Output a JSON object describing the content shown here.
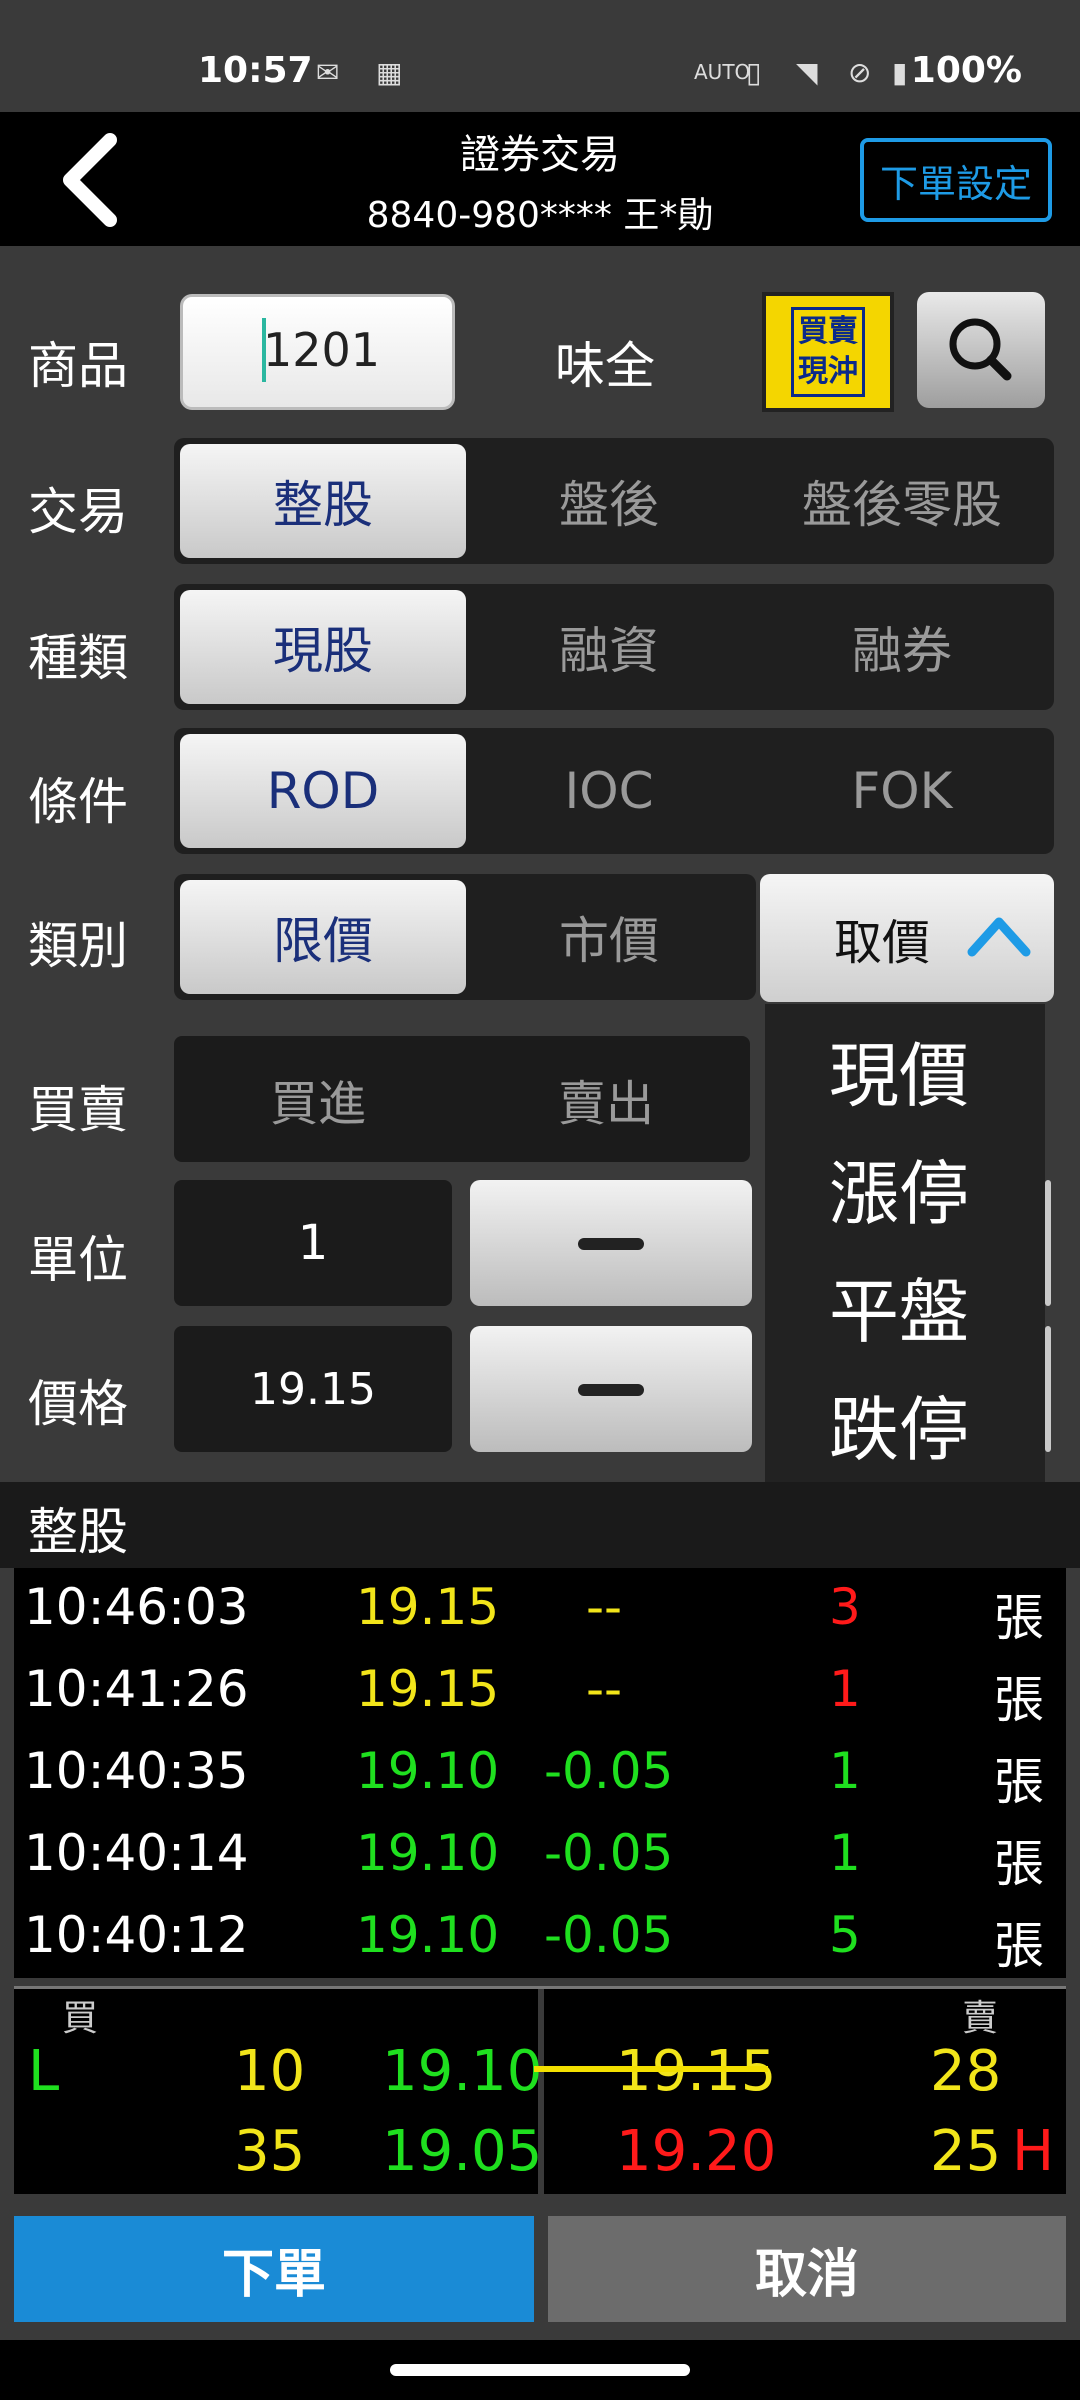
{
  "status_bar": {
    "time": "10:57",
    "battery": "100%",
    "icons": [
      "mail-icon",
      "calendar-icon",
      "auto-hz-icon",
      "vibrate-icon",
      "wifi-icon",
      "no-sim-icon",
      "battery-icon"
    ]
  },
  "header": {
    "title": "證券交易",
    "account": "8840-980**** 王*勛",
    "order_setting": "下單設定"
  },
  "form": {
    "product_label": "商品",
    "product_code": "1201",
    "product_name": "味全",
    "buysell_toggle": [
      "買賣",
      "現沖"
    ],
    "trade_label": "交易",
    "trade_options": [
      "整股",
      "盤後",
      "盤後零股"
    ],
    "trade_selected": 0,
    "kind_label": "種類",
    "kind_options": [
      "現股",
      "融資",
      "融券"
    ],
    "kind_selected": 0,
    "cond_label": "條件",
    "cond_options": [
      "ROD",
      "IOC",
      "FOK"
    ],
    "cond_selected": 0,
    "type_label": "類別",
    "type_options": [
      "限價",
      "市價"
    ],
    "type_selected": 0,
    "price_pick": "取價",
    "price_menu": [
      "現價",
      "漲停",
      "平盤",
      "跌停"
    ],
    "side_label": "買賣",
    "side_options": [
      "買進",
      "賣出"
    ],
    "unit_label": "單位",
    "unit_value": "1",
    "price_label": "價格",
    "price_value": "19.15"
  },
  "trades": {
    "title": "整股",
    "rows": [
      {
        "time": "10:46:03",
        "price": "19.15",
        "change": "--",
        "qty": "3",
        "unit": "張",
        "price_color": "#f2e51a",
        "chg_color": "#f2e51a",
        "qty_color": "#ff1a1a"
      },
      {
        "time": "10:41:26",
        "price": "19.15",
        "change": "--",
        "qty": "1",
        "unit": "張",
        "price_color": "#f2e51a",
        "chg_color": "#f2e51a",
        "qty_color": "#ff1a1a"
      },
      {
        "time": "10:40:35",
        "price": "19.10",
        "change": "-0.05",
        "qty": "1",
        "unit": "張",
        "price_color": "#1fe01f",
        "chg_color": "#1fe01f",
        "qty_color": "#1fe01f"
      },
      {
        "time": "10:40:14",
        "price": "19.10",
        "change": "-0.05",
        "qty": "1",
        "unit": "張",
        "price_color": "#1fe01f",
        "chg_color": "#1fe01f",
        "qty_color": "#1fe01f"
      },
      {
        "time": "10:40:12",
        "price": "19.10",
        "change": "-0.05",
        "qty": "5",
        "unit": "張",
        "price_color": "#1fe01f",
        "chg_color": "#1fe01f",
        "qty_color": "#1fe01f"
      }
    ]
  },
  "book": {
    "buy_label": "買",
    "sell_label": "賣",
    "rows": [
      {
        "bid_flag": "L",
        "bid_qty": "10",
        "bid_price": "19.10",
        "ask_price": "19.15",
        "ask_qty": "28",
        "ask_flag": ""
      },
      {
        "bid_flag": "",
        "bid_qty": "35",
        "bid_price": "19.05",
        "ask_price": "19.20",
        "ask_qty": "25",
        "ask_flag": "H"
      }
    ]
  },
  "actions": {
    "order": "下單",
    "cancel": "取消"
  },
  "colors": {
    "accent_blue": "#1a8bd6",
    "up_red": "#ff1a1a",
    "down_green": "#1fe01f",
    "flat_yellow": "#f2e51a"
  }
}
